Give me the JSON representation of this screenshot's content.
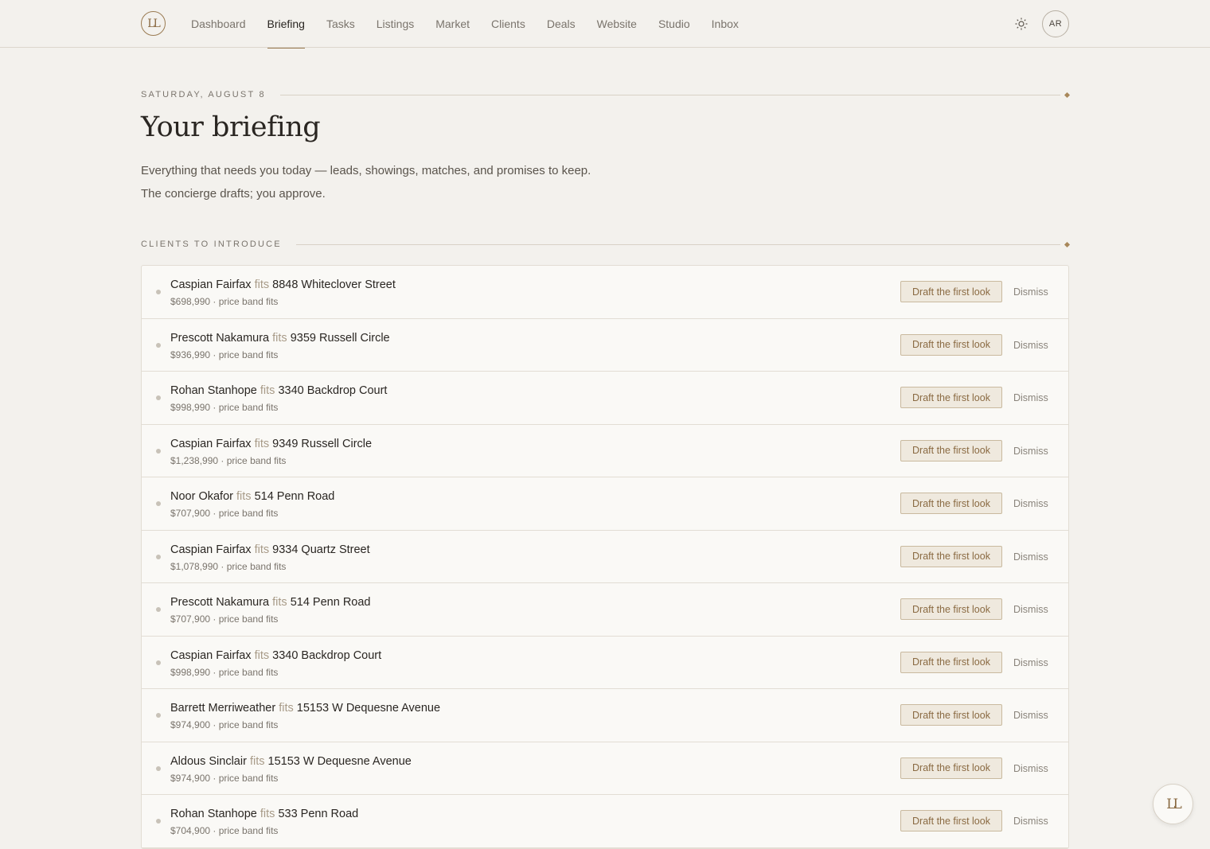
{
  "header": {
    "logo_text": "LL",
    "avatar_initials": "AR",
    "nav": [
      {
        "label": "Dashboard",
        "active": false
      },
      {
        "label": "Briefing",
        "active": true
      },
      {
        "label": "Tasks",
        "active": false
      },
      {
        "label": "Listings",
        "active": false
      },
      {
        "label": "Market",
        "active": false
      },
      {
        "label": "Clients",
        "active": false
      },
      {
        "label": "Deals",
        "active": false
      },
      {
        "label": "Website",
        "active": false
      },
      {
        "label": "Studio",
        "active": false
      },
      {
        "label": "Inbox",
        "active": false
      }
    ]
  },
  "page": {
    "date": "SATURDAY, AUGUST 8",
    "title": "Your briefing",
    "subtitle_line1": "Everything that needs you today — leads, showings, matches, and promises to keep.",
    "subtitle_line2": "The concierge drafts; you approve."
  },
  "section": {
    "heading": "CLIENTS TO INTRODUCE",
    "connector": "fits",
    "action_label": "Draft the first look",
    "dismiss_label": "Dismiss",
    "items": [
      {
        "client": "Caspian Fairfax",
        "property": "8848 Whiteclover Street",
        "detail": "$698,990 · price band fits"
      },
      {
        "client": "Prescott Nakamura",
        "property": "9359 Russell Circle",
        "detail": "$936,990 · price band fits"
      },
      {
        "client": "Rohan Stanhope",
        "property": "3340 Backdrop Court",
        "detail": "$998,990 · price band fits"
      },
      {
        "client": "Caspian Fairfax",
        "property": "9349 Russell Circle",
        "detail": "$1,238,990 · price band fits"
      },
      {
        "client": "Noor Okafor",
        "property": "514 Penn Road",
        "detail": "$707,900 · price band fits"
      },
      {
        "client": "Caspian Fairfax",
        "property": "9334 Quartz Street",
        "detail": "$1,078,990 · price band fits"
      },
      {
        "client": "Prescott Nakamura",
        "property": "514 Penn Road",
        "detail": "$707,900 · price band fits"
      },
      {
        "client": "Caspian Fairfax",
        "property": "3340 Backdrop Court",
        "detail": "$998,990 · price band fits"
      },
      {
        "client": "Barrett Merriweather",
        "property": "15153 W Dequesne Avenue",
        "detail": "$974,900 · price band fits"
      },
      {
        "client": "Aldous Sinclair",
        "property": "15153 W Dequesne Avenue",
        "detail": "$974,900 · price band fits"
      },
      {
        "client": "Rohan Stanhope",
        "property": "533 Penn Road",
        "detail": "$704,900 · price band fits"
      }
    ]
  },
  "fab": {
    "logo_text": "LL"
  },
  "colors": {
    "accent": "#9a7b52",
    "background": "#f3f1ed",
    "card": "#faf9f6"
  }
}
